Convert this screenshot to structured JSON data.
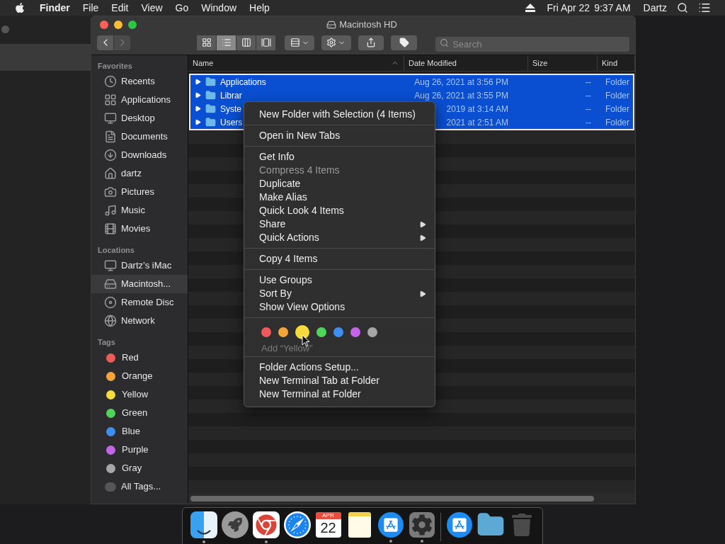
{
  "menu_bar": {
    "app": "Finder",
    "menus": [
      "File",
      "Edit",
      "View",
      "Go",
      "Window",
      "Help"
    ],
    "date": "Fri Apr 22",
    "time": "9:37 AM",
    "user": "Dartz"
  },
  "window": {
    "title": "Macintosh HD"
  },
  "toolbar": {
    "views": [
      {
        "kind": "icons",
        "selected": false
      },
      {
        "kind": "list",
        "selected": true
      },
      {
        "kind": "columns",
        "selected": false
      },
      {
        "kind": "gallery",
        "selected": false
      }
    ],
    "search": {
      "placeholder": "Search"
    }
  },
  "sidebar": {
    "sections": [
      {
        "heading": "Favorites",
        "items": [
          {
            "label": "Recents",
            "kind": "recents",
            "selected": false
          },
          {
            "label": "Applications",
            "kind": "applications",
            "selected": false
          },
          {
            "label": "Desktop",
            "kind": "desktop",
            "selected": false
          },
          {
            "label": "Documents",
            "kind": "documents",
            "selected": false
          },
          {
            "label": "Downloads",
            "kind": "downloads",
            "selected": false
          },
          {
            "label": "dartz",
            "kind": "home",
            "selected": false
          },
          {
            "label": "Pictures",
            "kind": "pictures",
            "selected": false
          },
          {
            "label": "Music",
            "kind": "music",
            "selected": false
          },
          {
            "label": "Movies",
            "kind": "movies",
            "selected": false
          }
        ]
      },
      {
        "heading": "Locations",
        "items": [
          {
            "label": "Dartz’s iMac",
            "kind": "computer",
            "selected": false
          },
          {
            "label": "Macintosh...",
            "kind": "disk",
            "selected": true
          },
          {
            "label": "Remote Disc",
            "kind": "disc",
            "selected": false
          },
          {
            "label": "Network",
            "kind": "network",
            "selected": false
          }
        ]
      },
      {
        "heading": "Tags",
        "items": [
          {
            "label": "Red",
            "kind": "tag",
            "color": "#ef5b5b",
            "selected": false
          },
          {
            "label": "Orange",
            "kind": "tag",
            "color": "#f4a53a",
            "selected": false
          },
          {
            "label": "Yellow",
            "kind": "tag",
            "color": "#f5dc3a",
            "selected": false
          },
          {
            "label": "Green",
            "kind": "tag",
            "color": "#4fd65a",
            "selected": false
          },
          {
            "label": "Blue",
            "kind": "tag",
            "color": "#3d8ff5",
            "selected": false
          },
          {
            "label": "Purple",
            "kind": "tag",
            "color": "#c464e8",
            "selected": false
          },
          {
            "label": "Gray",
            "kind": "tag",
            "color": "#a6a6a6",
            "selected": false
          },
          {
            "label": "All Tags...",
            "kind": "all_tags",
            "selected": false
          }
        ]
      }
    ]
  },
  "table": {
    "columns": [
      {
        "label": "Name",
        "sorted": true
      },
      {
        "label": "Date Modified",
        "sorted": false
      },
      {
        "label": "Size",
        "sorted": false
      },
      {
        "label": "Kind",
        "sorted": false
      }
    ],
    "rows": [
      {
        "name": "Applications",
        "date": "Aug 26, 2021 at 3:56 PM",
        "size": "--",
        "kind": "Folder",
        "selected": true
      },
      {
        "name": "Librar",
        "date": "Aug 26, 2021 at 3:55 PM",
        "size": "--",
        "kind": "Folder",
        "selected": true
      },
      {
        "name": "Syste",
        "date": "2019 at 3:14 AM",
        "size": "--",
        "kind": "Folder",
        "selected": true
      },
      {
        "name": "Users",
        "date": "2021 at 2:51 AM",
        "size": "--",
        "kind": "Folder",
        "selected": true
      }
    ]
  },
  "context_menu": {
    "sections": [
      {
        "items": [
          {
            "label": "New Folder with Selection (4 Items)",
            "disabled": false,
            "submenu": false
          }
        ]
      },
      {
        "items": [
          {
            "label": "Open in New Tabs",
            "disabled": false,
            "submenu": false
          }
        ]
      },
      {
        "items": [
          {
            "label": "Get Info",
            "disabled": false,
            "submenu": false
          },
          {
            "label": "Compress 4 Items",
            "disabled": true,
            "submenu": false
          },
          {
            "label": "Duplicate",
            "disabled": false,
            "submenu": false
          },
          {
            "label": "Make Alias",
            "disabled": false,
            "submenu": false
          },
          {
            "label": "Quick Look 4 Items",
            "disabled": false,
            "submenu": false
          },
          {
            "label": "Share",
            "disabled": false,
            "submenu": true
          },
          {
            "label": "Quick Actions",
            "disabled": false,
            "submenu": true
          }
        ]
      },
      {
        "items": [
          {
            "label": "Copy 4 Items",
            "disabled": false,
            "submenu": false
          }
        ]
      },
      {
        "items": [
          {
            "label": "Use Groups",
            "disabled": false,
            "submenu": false
          },
          {
            "label": "Sort By",
            "disabled": false,
            "submenu": true
          },
          {
            "label": "Show View Options",
            "disabled": false,
            "submenu": false
          }
        ]
      },
      {
        "tags": [
          {
            "color": "#ef5b5b",
            "selected": false
          },
          {
            "color": "#f4a53a",
            "selected": false
          },
          {
            "color": "#f5dc3a",
            "selected": true
          },
          {
            "color": "#4fd65a",
            "selected": false
          },
          {
            "color": "#3d8ff5",
            "selected": false
          },
          {
            "color": "#c464e8",
            "selected": false
          },
          {
            "color": "#a6a6a6",
            "selected": false
          }
        ],
        "hint": "Add “Yellow”"
      },
      {
        "items": [
          {
            "label": "Folder Actions Setup...",
            "disabled": false,
            "submenu": false
          },
          {
            "label": "New Terminal Tab at Folder",
            "disabled": false,
            "submenu": false
          },
          {
            "label": "New Terminal at Folder",
            "disabled": false,
            "submenu": false
          }
        ]
      }
    ]
  },
  "dock": {
    "apps": [
      {
        "kind": "finder",
        "running": true
      },
      {
        "kind": "launchpad",
        "running": false
      },
      {
        "kind": "chrome",
        "running": true
      },
      {
        "kind": "safari",
        "running": false
      },
      {
        "kind": "calendar",
        "running": false,
        "month": "APR",
        "day": "22"
      },
      {
        "kind": "notes",
        "running": false
      },
      {
        "kind": "appstore",
        "running": true
      },
      {
        "kind": "settings",
        "running": true
      },
      {
        "kind": "divider"
      },
      {
        "kind": "appstore",
        "running": false
      },
      {
        "kind": "folder",
        "running": false
      },
      {
        "kind": "trash",
        "running": false
      }
    ]
  }
}
